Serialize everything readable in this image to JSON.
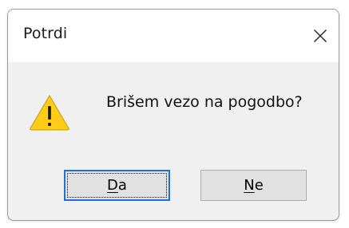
{
  "window": {
    "title": "Potrdi",
    "close_icon": "close-icon"
  },
  "message": {
    "icon": "warning-icon",
    "text": "Brišem vezo na pogodbo?"
  },
  "buttons": {
    "yes": {
      "mnemonic": "D",
      "rest": "a"
    },
    "no": {
      "mnemonic": "N",
      "rest": "e"
    }
  },
  "colors": {
    "warning_fill": "#FFCC1A",
    "focus_border": "#1E6FD6",
    "button_face": "#E1E1E1",
    "dialog_body": "#F0F0F0"
  }
}
